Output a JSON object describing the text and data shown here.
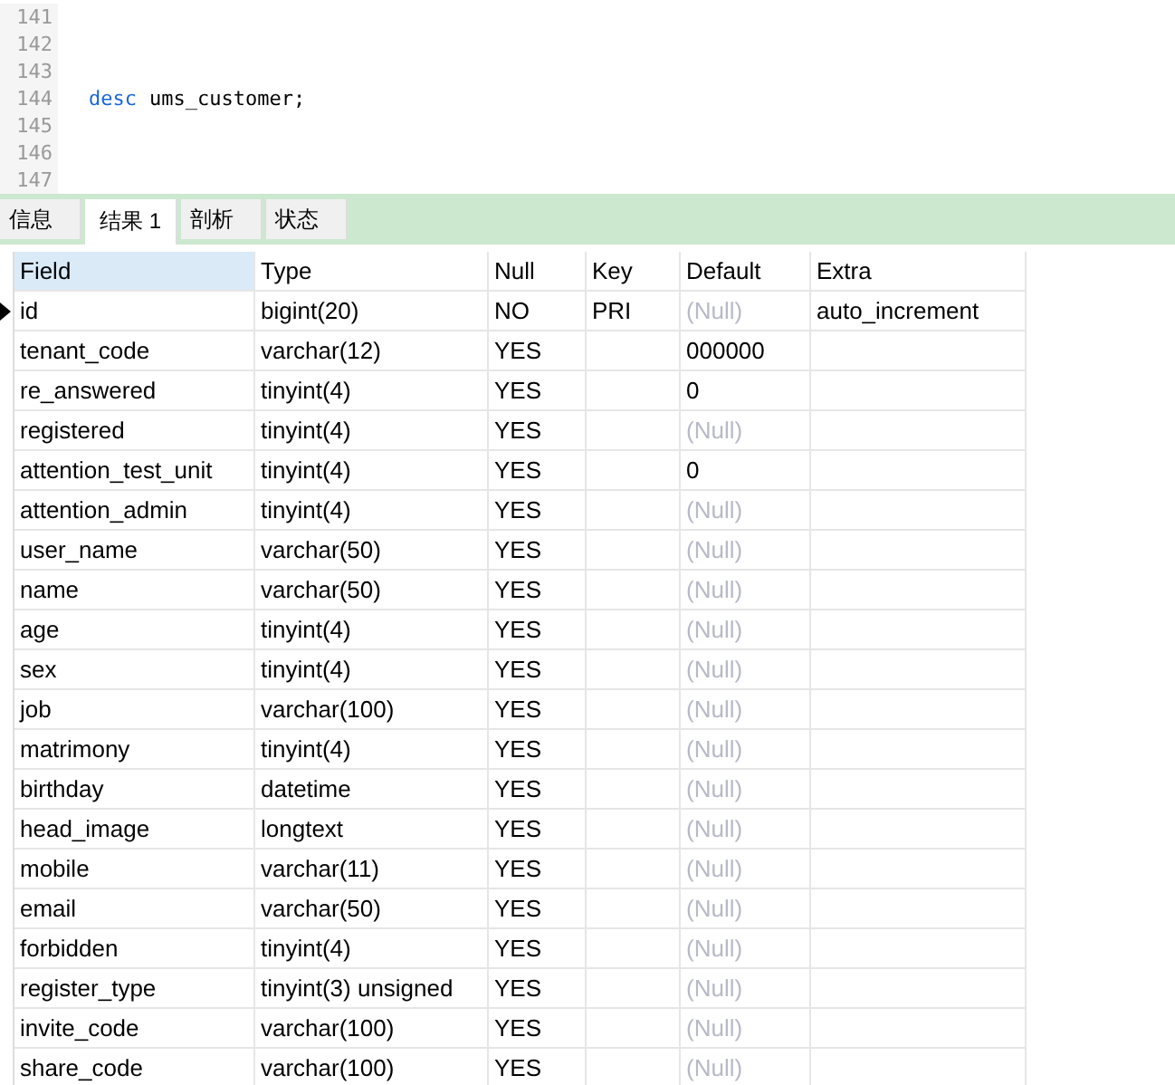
{
  "editor": {
    "lines": [
      {
        "number": "141"
      },
      {
        "number": "142"
      },
      {
        "number": "143"
      },
      {
        "number": "144",
        "tokens": [
          {
            "text": "desc",
            "kind": "keyword"
          },
          {
            "text": "ums_customer;",
            "kind": "plain"
          }
        ]
      },
      {
        "number": "145"
      },
      {
        "number": "146"
      },
      {
        "number": "147"
      }
    ]
  },
  "tabs": [
    {
      "label": "信息",
      "selected": false
    },
    {
      "label": "结果 1",
      "selected": true
    },
    {
      "label": "剖析",
      "selected": false
    },
    {
      "label": "状态",
      "selected": false
    }
  ],
  "table": {
    "columns": [
      {
        "label": "Field",
        "selected": true
      },
      {
        "label": "Type",
        "selected": false
      },
      {
        "label": "Null",
        "selected": false
      },
      {
        "label": "Key",
        "selected": false
      },
      {
        "label": "Default",
        "selected": false
      },
      {
        "label": "Extra",
        "selected": false
      }
    ],
    "rows": [
      {
        "current": true,
        "null_default": true,
        "cells": [
          "id",
          "bigint(20)",
          "NO",
          "PRI",
          "(Null)",
          "auto_increment"
        ]
      },
      {
        "current": false,
        "null_default": false,
        "cells": [
          "tenant_code",
          "varchar(12)",
          "YES",
          "",
          "000000",
          ""
        ]
      },
      {
        "current": false,
        "null_default": false,
        "cells": [
          "re_answered",
          "tinyint(4)",
          "YES",
          "",
          "0",
          ""
        ]
      },
      {
        "current": false,
        "null_default": true,
        "cells": [
          "registered",
          "tinyint(4)",
          "YES",
          "",
          "(Null)",
          ""
        ]
      },
      {
        "current": false,
        "null_default": false,
        "cells": [
          "attention_test_unit",
          "tinyint(4)",
          "YES",
          "",
          "0",
          ""
        ]
      },
      {
        "current": false,
        "null_default": true,
        "cells": [
          "attention_admin",
          "tinyint(4)",
          "YES",
          "",
          "(Null)",
          ""
        ]
      },
      {
        "current": false,
        "null_default": true,
        "cells": [
          "user_name",
          "varchar(50)",
          "YES",
          "",
          "(Null)",
          ""
        ]
      },
      {
        "current": false,
        "null_default": true,
        "cells": [
          "name",
          "varchar(50)",
          "YES",
          "",
          "(Null)",
          ""
        ]
      },
      {
        "current": false,
        "null_default": true,
        "cells": [
          "age",
          "tinyint(4)",
          "YES",
          "",
          "(Null)",
          ""
        ]
      },
      {
        "current": false,
        "null_default": true,
        "cells": [
          "sex",
          "tinyint(4)",
          "YES",
          "",
          "(Null)",
          ""
        ]
      },
      {
        "current": false,
        "null_default": true,
        "cells": [
          "job",
          "varchar(100)",
          "YES",
          "",
          "(Null)",
          ""
        ]
      },
      {
        "current": false,
        "null_default": true,
        "cells": [
          "matrimony",
          "tinyint(4)",
          "YES",
          "",
          "(Null)",
          ""
        ]
      },
      {
        "current": false,
        "null_default": true,
        "cells": [
          "birthday",
          "datetime",
          "YES",
          "",
          "(Null)",
          ""
        ]
      },
      {
        "current": false,
        "null_default": true,
        "cells": [
          "head_image",
          "longtext",
          "YES",
          "",
          "(Null)",
          ""
        ]
      },
      {
        "current": false,
        "null_default": true,
        "cells": [
          "mobile",
          "varchar(11)",
          "YES",
          "",
          "(Null)",
          ""
        ]
      },
      {
        "current": false,
        "null_default": true,
        "cells": [
          "email",
          "varchar(50)",
          "YES",
          "",
          "(Null)",
          ""
        ]
      },
      {
        "current": false,
        "null_default": true,
        "cells": [
          "forbidden",
          "tinyint(4)",
          "YES",
          "",
          "(Null)",
          ""
        ]
      },
      {
        "current": false,
        "null_default": true,
        "cells": [
          "register_type",
          "tinyint(3) unsigned",
          "YES",
          "",
          "(Null)",
          ""
        ]
      },
      {
        "current": false,
        "null_default": true,
        "cells": [
          "invite_code",
          "varchar(100)",
          "YES",
          "",
          "(Null)",
          ""
        ]
      },
      {
        "current": false,
        "null_default": true,
        "cells": [
          "share_code",
          "varchar(100)",
          "YES",
          "",
          "(Null)",
          ""
        ]
      }
    ]
  }
}
